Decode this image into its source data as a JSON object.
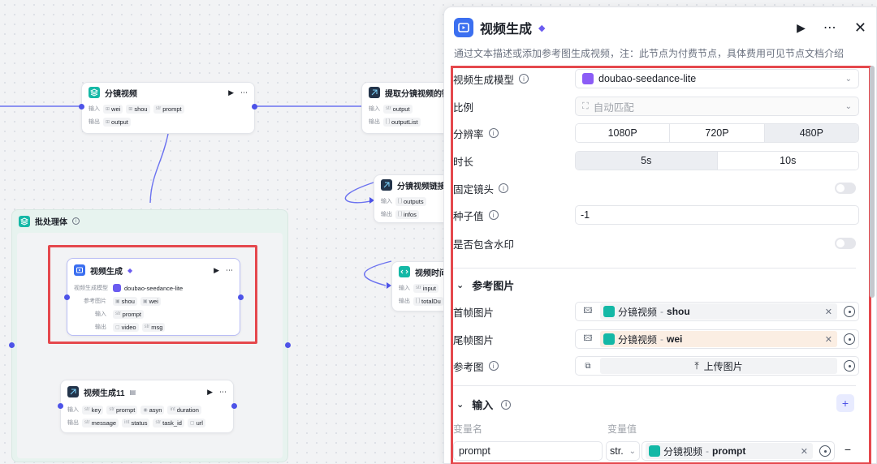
{
  "canvas": {
    "node_split": {
      "title": "分镜视频",
      "input_label": "输入",
      "output_label": "输出",
      "inputs": [
        "wei",
        "shou",
        "prompt"
      ],
      "outputs": [
        "output"
      ]
    },
    "node_extract": {
      "title": "提取分镜视频的链",
      "input_label": "输入",
      "output_label": "输出",
      "inputs": [
        "output"
      ],
      "outputs": [
        "outputList"
      ]
    },
    "node_link": {
      "title": "分镜视频链接",
      "input_label": "输入",
      "output_label": "输出",
      "inputs": [
        "outputs"
      ],
      "outputs": [
        "infos"
      ]
    },
    "node_time": {
      "title": "视频时间",
      "input_label": "输入",
      "output_label": "输出",
      "inputs": [
        "input"
      ],
      "outputs": [
        "totalDu"
      ]
    },
    "group": {
      "title": "批处理体"
    },
    "node_video": {
      "title": "视频生成",
      "model_label": "视频生成模型",
      "model_value": "doubao-seedance-lite",
      "ref_label": "参考图片",
      "refs": [
        "shou",
        "wei"
      ],
      "input_label": "输入",
      "inputs": [
        "prompt"
      ],
      "output_label": "输出",
      "outputs": [
        "video",
        "msg"
      ]
    },
    "node_video11": {
      "title": "视频生成11",
      "input_label": "输入",
      "output_label": "输出",
      "inputs": [
        "key",
        "prompt",
        "asyn",
        "duration"
      ],
      "outputs": [
        "message",
        "status",
        "task_id",
        "url"
      ]
    }
  },
  "panel": {
    "title": "视频生成",
    "description": "通过文本描述或添加参考图生成视频，注：此节点为付费节点，具体费用可见节点文档介绍",
    "fields": {
      "model": {
        "label": "视频生成模型",
        "value": "doubao-seedance-lite"
      },
      "ratio": {
        "label": "比例",
        "value": "自动匹配"
      },
      "resolution": {
        "label": "分辨率",
        "options": [
          "1080P",
          "720P",
          "480P"
        ],
        "selected": "480P"
      },
      "duration": {
        "label": "时长",
        "options": [
          "5s",
          "10s"
        ],
        "selected": "5s"
      },
      "fixed_camera": {
        "label": "固定镜头",
        "on": false
      },
      "seed": {
        "label": "种子值",
        "value": "-1"
      },
      "watermark": {
        "label": "是否包含水印",
        "on": false
      }
    },
    "ref_section": {
      "title": "参考图片",
      "first_frame": {
        "label": "首帧图片",
        "source": "分镜视频",
        "sep": "-",
        "var": "shou"
      },
      "last_frame": {
        "label": "尾帧图片",
        "source": "分镜视频",
        "sep": "-",
        "var": "wei"
      },
      "ref_image": {
        "label": "参考图",
        "upload": "上传图片"
      }
    },
    "input_section": {
      "title": "输入",
      "col_name": "变量名",
      "col_value": "变量值",
      "rows": [
        {
          "name": "prompt",
          "type": "str.",
          "source": "分镜视频",
          "sep": "-",
          "var": "prompt"
        }
      ]
    }
  },
  "colors": {
    "accent": "#4d53e8",
    "highlight": "#e5484d",
    "teal": "#14b8a6",
    "blue": "#3b6ff0"
  }
}
